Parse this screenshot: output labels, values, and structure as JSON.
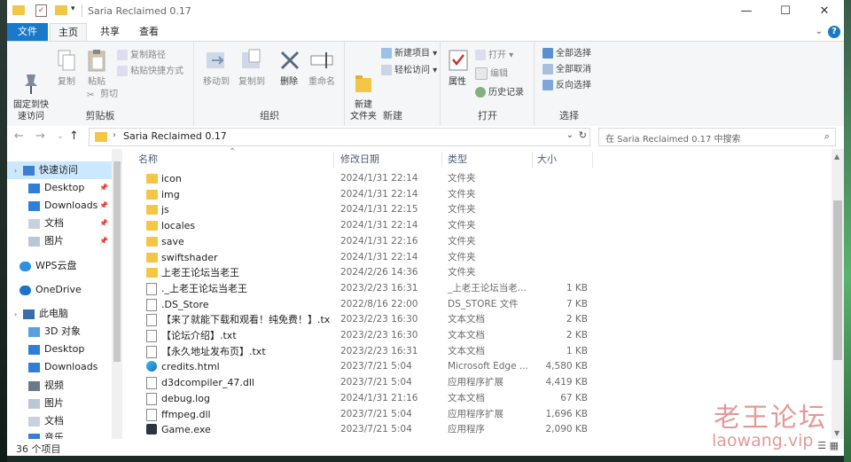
{
  "window": {
    "title": "Saria Reclaimed 0.17",
    "minimize": "—",
    "maximize": "☐",
    "close": "✕"
  },
  "tabs": {
    "file": "文件",
    "home": "主页",
    "share": "共享",
    "view": "查看",
    "help": "?"
  },
  "ribbon": {
    "clipboard": {
      "label": "剪贴板",
      "pin": "固定到快\n速访问",
      "copy": "复制",
      "paste": "粘贴",
      "copy_path": "复制路径",
      "paste_shortcut": "粘贴快捷方式",
      "cut": "剪切"
    },
    "organize": {
      "label": "组织",
      "move_to": "移动到",
      "copy_to": "复制到",
      "delete": "删除",
      "rename": "重命名"
    },
    "new": {
      "label": "新建",
      "new_folder": "新建\n文件夹",
      "new_item": "新建项目 ▾",
      "easy_access": "轻松访问 ▾"
    },
    "open": {
      "label": "打开",
      "properties": "属性",
      "open": "打开 ▾",
      "edit": "编辑",
      "history": "历史记录"
    },
    "select": {
      "label": "选择",
      "select_all": "全部选择",
      "select_none": "全部取消",
      "invert": "反向选择"
    }
  },
  "address": {
    "path": "Saria Reclaimed 0.17",
    "search_placeholder": "在 Saria Reclaimed 0.17 中搜索"
  },
  "nav": [
    {
      "label": "快速访问",
      "icon": "star-icon",
      "sel": true
    },
    {
      "label": "Desktop",
      "icon": "desktop-icon",
      "pin": true
    },
    {
      "label": "Downloads",
      "icon": "download-icon",
      "pin": true
    },
    {
      "label": "文档",
      "icon": "document-icon",
      "pin": true
    },
    {
      "label": "图片",
      "icon": "pictures-icon",
      "pin": true
    },
    {
      "label": "WPS云盘",
      "icon": "cloud-icon"
    },
    {
      "label": "OneDrive",
      "icon": "onedrive-icon"
    },
    {
      "label": "此电脑",
      "icon": "computer-icon"
    },
    {
      "label": "3D 对象",
      "icon": "cube-icon"
    },
    {
      "label": "Desktop",
      "icon": "desktop-icon"
    },
    {
      "label": "Downloads",
      "icon": "download-icon"
    },
    {
      "label": "视频",
      "icon": "video-icon"
    },
    {
      "label": "图片",
      "icon": "pictures-icon"
    },
    {
      "label": "文档",
      "icon": "document-icon"
    },
    {
      "label": "音乐",
      "icon": "music-icon"
    }
  ],
  "columns": {
    "name": "名称",
    "date": "修改日期",
    "type": "类型",
    "size": "大小"
  },
  "files": [
    {
      "name": "icon",
      "date": "2024/1/31 22:14",
      "type": "文件夹",
      "size": "",
      "icon": "folder"
    },
    {
      "name": "img",
      "date": "2024/1/31 22:14",
      "type": "文件夹",
      "size": "",
      "icon": "folder"
    },
    {
      "name": "js",
      "date": "2024/1/31 22:15",
      "type": "文件夹",
      "size": "",
      "icon": "folder"
    },
    {
      "name": "locales",
      "date": "2024/1/31 22:14",
      "type": "文件夹",
      "size": "",
      "icon": "folder"
    },
    {
      "name": "save",
      "date": "2024/1/31 22:16",
      "type": "文件夹",
      "size": "",
      "icon": "folder"
    },
    {
      "name": "swiftshader",
      "date": "2024/1/31 22:14",
      "type": "文件夹",
      "size": "",
      "icon": "folder"
    },
    {
      "name": "上老王论坛当老王",
      "date": "2024/2/26 14:36",
      "type": "文件夹",
      "size": "",
      "icon": "folder"
    },
    {
      "name": "._上老王论坛当老王",
      "date": "2023/2/23 16:31",
      "type": "_上老王论坛当老...",
      "size": "1 KB",
      "icon": "doc"
    },
    {
      "name": ".DS_Store",
      "date": "2022/8/16 22:00",
      "type": "DS_STORE 文件",
      "size": "7 KB",
      "icon": "doc"
    },
    {
      "name": "【来了就能下载和观看！纯免费！】.txt",
      "date": "2023/2/23 16:30",
      "type": "文本文档",
      "size": "2 KB",
      "icon": "doc"
    },
    {
      "name": "【论坛介绍】.txt",
      "date": "2023/2/23 16:30",
      "type": "文本文档",
      "size": "2 KB",
      "icon": "doc"
    },
    {
      "name": "【永久地址发布页】.txt",
      "date": "2023/2/23 16:31",
      "type": "文本文档",
      "size": "1 KB",
      "icon": "doc"
    },
    {
      "name": "credits.html",
      "date": "2023/7/21 5:04",
      "type": "Microsoft Edge ...",
      "size": "4,580 KB",
      "icon": "edge"
    },
    {
      "name": "d3dcompiler_47.dll",
      "date": "2023/7/21 5:04",
      "type": "应用程序扩展",
      "size": "4,419 KB",
      "icon": "doc"
    },
    {
      "name": "debug.log",
      "date": "2024/1/31 21:16",
      "type": "文本文档",
      "size": "67 KB",
      "icon": "doc"
    },
    {
      "name": "ffmpeg.dll",
      "date": "2023/7/21 5:04",
      "type": "应用程序扩展",
      "size": "1,696 KB",
      "icon": "doc"
    },
    {
      "name": "Game.exe",
      "date": "2023/7/21 5:04",
      "type": "应用程序",
      "size": "2,090 KB",
      "icon": "exe"
    }
  ],
  "status": {
    "count": "36 个项目"
  },
  "watermark": {
    "cn": "老王论坛",
    "en": "laowang.vip"
  }
}
